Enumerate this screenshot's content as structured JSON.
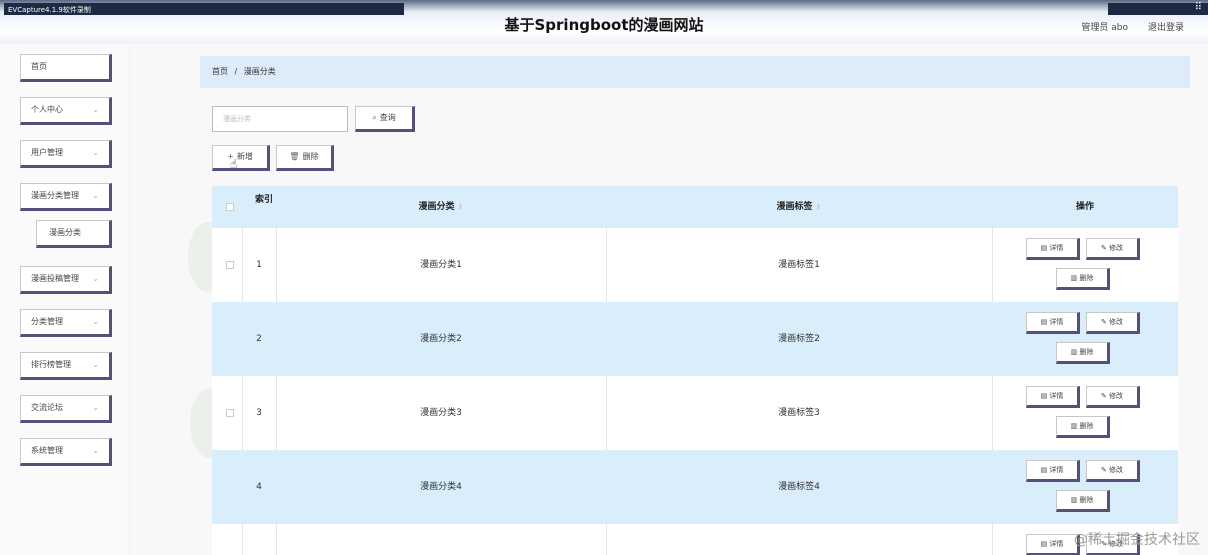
{
  "top": {
    "recorder": "EVCapture4.1.9软件录制",
    "title": "基于Springboot的漫画网站",
    "admin": "管理员 abo",
    "logout": "退出登录"
  },
  "sidebar": {
    "items": [
      {
        "label": "首页"
      },
      {
        "label": "个人中心"
      },
      {
        "label": "用户管理"
      },
      {
        "label": "漫画分类管理"
      },
      {
        "label": "漫画分类"
      },
      {
        "label": "漫画投稿管理"
      },
      {
        "label": "分类管理"
      },
      {
        "label": "排行榜管理"
      },
      {
        "label": "交流论坛"
      },
      {
        "label": "系统管理"
      }
    ]
  },
  "breadcrumb": {
    "home": "首页",
    "sep": "/",
    "current": "漫画分类"
  },
  "search": {
    "placeholder": "漫画分类",
    "button": "查询"
  },
  "toolbar": {
    "add": "新增",
    "delete": "删除"
  },
  "table": {
    "headers": {
      "index": "索引",
      "category": "漫画分类",
      "tag": "漫画标签",
      "ops": "操作"
    },
    "rows": [
      {
        "index": "1",
        "category": "漫画分类1",
        "tag": "漫画标签1"
      },
      {
        "index": "2",
        "category": "漫画分类2",
        "tag": "漫画标签2"
      },
      {
        "index": "3",
        "category": "漫画分类3",
        "tag": "漫画标签3"
      },
      {
        "index": "4",
        "category": "漫画分类4",
        "tag": "漫画标签4"
      }
    ],
    "actions": {
      "detail": "详情",
      "edit": "修改",
      "delete": "删除"
    }
  },
  "watermark": "@稀土掘金技术社区",
  "colors": {
    "accent_border": "#55507a",
    "row_highlight": "#d9edfb"
  }
}
